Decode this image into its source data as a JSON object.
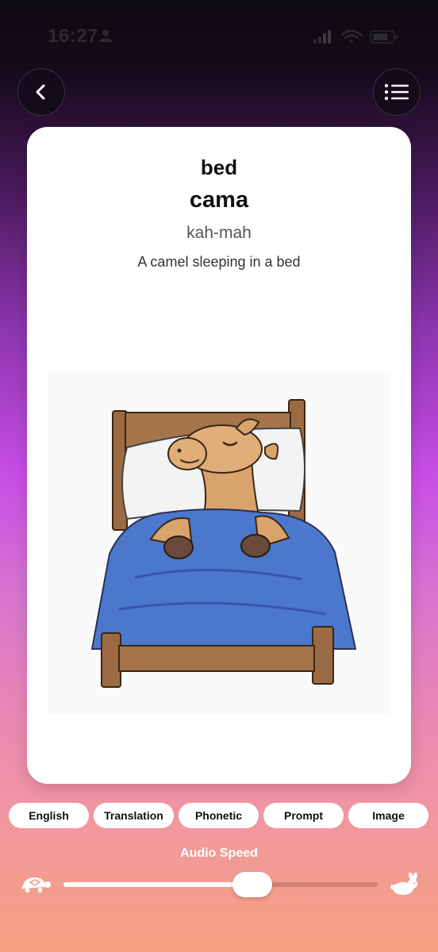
{
  "status": {
    "time": "16:27"
  },
  "nav": {
    "back_icon": "chevron-left-icon",
    "menu_icon": "list-icon"
  },
  "card": {
    "word_english": "bed",
    "word_translation": "cama",
    "phonetic": "kah-mah",
    "prompt": "A camel sleeping in a bed",
    "image_subject": "camel-in-bed-illustration"
  },
  "toggles": [
    {
      "label": "English"
    },
    {
      "label": "Translation"
    },
    {
      "label": "Phonetic"
    },
    {
      "label": "Prompt"
    },
    {
      "label": "Image"
    }
  ],
  "audio": {
    "label": "Audio Speed",
    "speed_fraction": 0.6,
    "slow_icon": "turtle-icon",
    "fast_icon": "rabbit-icon"
  }
}
